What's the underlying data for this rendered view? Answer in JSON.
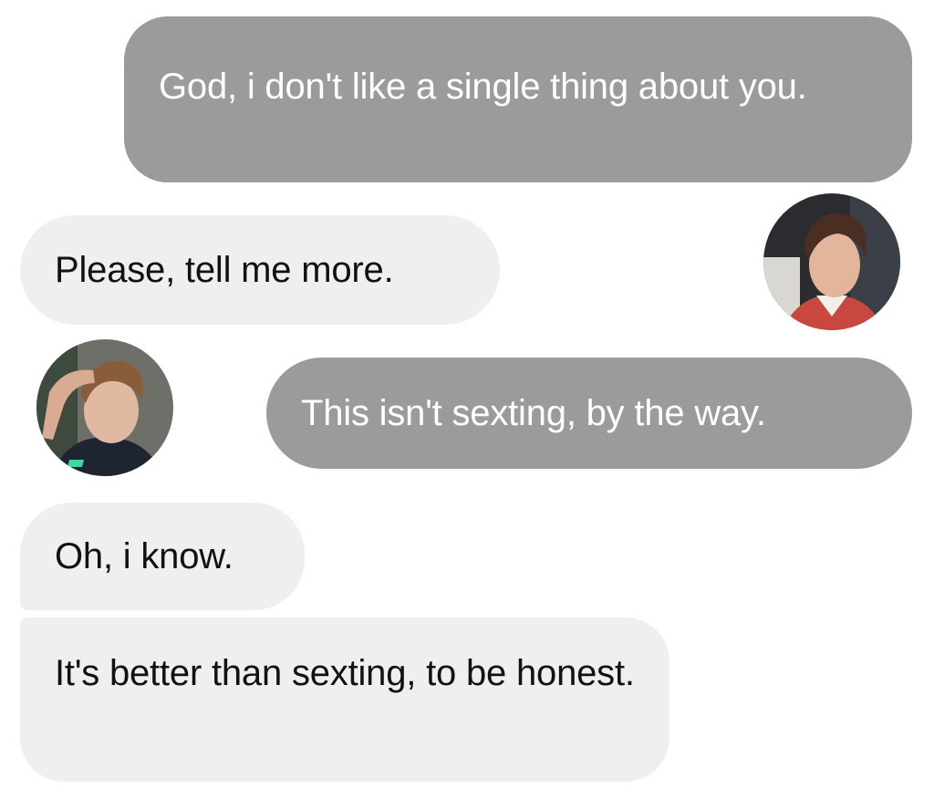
{
  "messages": [
    {
      "id": 1,
      "side": "sent",
      "text": "God, i don't like a single thing about you."
    },
    {
      "id": 2,
      "side": "received",
      "text": "Please, tell me more."
    },
    {
      "id": 3,
      "side": "sent",
      "text": "This isn't sexting, by the way."
    },
    {
      "id": 4,
      "side": "received",
      "text": "Oh, i know."
    },
    {
      "id": 5,
      "side": "received",
      "text": "It's better than sexting, to be honest."
    }
  ],
  "avatars": [
    {
      "icon": "profile-photo-icon",
      "description_color": "#c8473f"
    },
    {
      "icon": "profile-photo-icon",
      "description_color": "#1e2530"
    }
  ],
  "colors": {
    "sent_bubble": "#9b9b9b",
    "received_bubble": "#efefef",
    "sent_text": "#ffffff",
    "received_text": "#111111"
  }
}
